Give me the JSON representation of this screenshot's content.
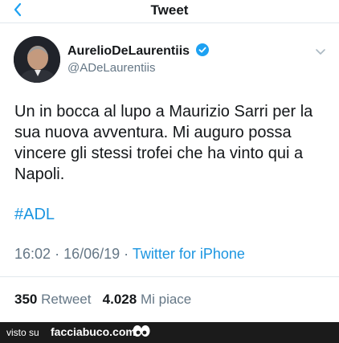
{
  "nav": {
    "title": "Tweet"
  },
  "author": {
    "name": "AurelioDeLaurentiis",
    "handle": "@ADeLaurentiis"
  },
  "tweet": {
    "lines": [
      "Un in bocca al lupo a Maurizio Sarri per la",
      "sua nuova avventura. Mi auguro possa",
      "vincere gli stessi trofei che ha vinto qui a",
      "Napoli."
    ],
    "hashtag": "#ADL",
    "time": "16:02",
    "date": "16/06/19",
    "separator1": "·",
    "separator2": "·",
    "source": "Twitter for iPhone"
  },
  "stats": {
    "retweets": "350",
    "retweets_label": "Retweet",
    "likes": "4.028",
    "likes_label": "Mi piace"
  },
  "watermark": {
    "prefix": "visto su",
    "brand": "facciabuco.com"
  },
  "colors": {
    "link": "#1b95e0",
    "verified": "#1da1f2",
    "muted": "#657786"
  },
  "icons": {
    "back": "chevron-left-icon",
    "verified": "verified-badge-icon",
    "more": "chevron-down-icon"
  }
}
